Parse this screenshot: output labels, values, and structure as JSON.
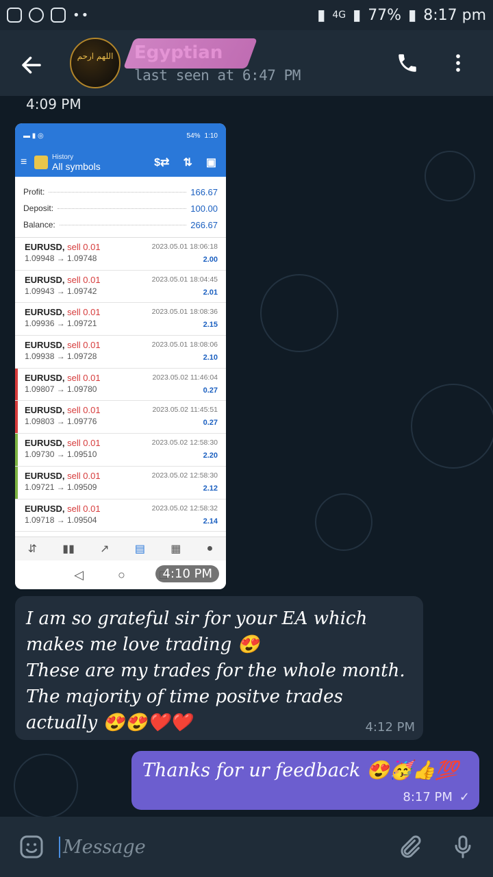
{
  "status_bar": {
    "network": "4G",
    "battery": "77%",
    "time": "8:17 pm"
  },
  "header": {
    "contact_name": "Egyptian",
    "last_seen": "last seen at 6:47 PM",
    "avatar_text": "اللهم ارحم"
  },
  "chat": {
    "partial_time": "4:09 PM",
    "image_message": {
      "time": "4:10 PM",
      "screenshot": {
        "status_battery": "54%",
        "status_time": "1:10",
        "title_top": "History",
        "title_main": "All symbols",
        "summary": [
          {
            "label": "Profit:",
            "value": "166.67"
          },
          {
            "label": "Deposit:",
            "value": "100.00"
          },
          {
            "label": "Balance:",
            "value": "266.67"
          }
        ],
        "trades": [
          {
            "symbol": "EURUSD,",
            "side": "sell 0.01",
            "prices": "1.09948 → 1.09748",
            "date": "2023.05.01 18:06:18",
            "profit": "2.00",
            "mark": ""
          },
          {
            "symbol": "EURUSD,",
            "side": "sell 0.01",
            "prices": "1.09943 → 1.09742",
            "date": "2023.05.01 18:04:45",
            "profit": "2.01",
            "mark": ""
          },
          {
            "symbol": "EURUSD,",
            "side": "sell 0.01",
            "prices": "1.09936 → 1.09721",
            "date": "2023.05.01 18:08:36",
            "profit": "2.15",
            "mark": ""
          },
          {
            "symbol": "EURUSD,",
            "side": "sell 0.01",
            "prices": "1.09938 → 1.09728",
            "date": "2023.05.01 18:08:06",
            "profit": "2.10",
            "mark": ""
          },
          {
            "symbol": "EURUSD,",
            "side": "sell 0.01",
            "prices": "1.09807 → 1.09780",
            "date": "2023.05.02 11:46:04",
            "profit": "0.27",
            "mark": "#d63b3b"
          },
          {
            "symbol": "EURUSD,",
            "side": "sell 0.01",
            "prices": "1.09803 → 1.09776",
            "date": "2023.05.02 11:45:51",
            "profit": "0.27",
            "mark": "#d63b3b"
          },
          {
            "symbol": "EURUSD,",
            "side": "sell 0.01",
            "prices": "1.09730 → 1.09510",
            "date": "2023.05.02 12:58:30",
            "profit": "2.20",
            "mark": "#7cb342"
          },
          {
            "symbol": "EURUSD,",
            "side": "sell 0.01",
            "prices": "1.09721 → 1.09509",
            "date": "2023.05.02 12:58:30",
            "profit": "2.12",
            "mark": "#7cb342"
          },
          {
            "symbol": "EURUSD,",
            "side": "sell 0.01",
            "prices": "1.09718 → 1.09504",
            "date": "2023.05.02 12:58:32",
            "profit": "2.14",
            "mark": ""
          }
        ]
      }
    },
    "incoming": {
      "line1": "I am so grateful sir for your EA which",
      "line2": "makes me love trading 😍",
      "line3": "These are my trades for the whole month.",
      "line4": "The majority of time positve trades",
      "line5": "actually 😍😍❤️❤️",
      "time": "4:12 PM"
    },
    "outgoing": {
      "text": "Thanks for ur feedback 😍🥳👍💯",
      "time": "8:17 PM",
      "status": "✓"
    }
  },
  "input": {
    "placeholder": "Message"
  }
}
